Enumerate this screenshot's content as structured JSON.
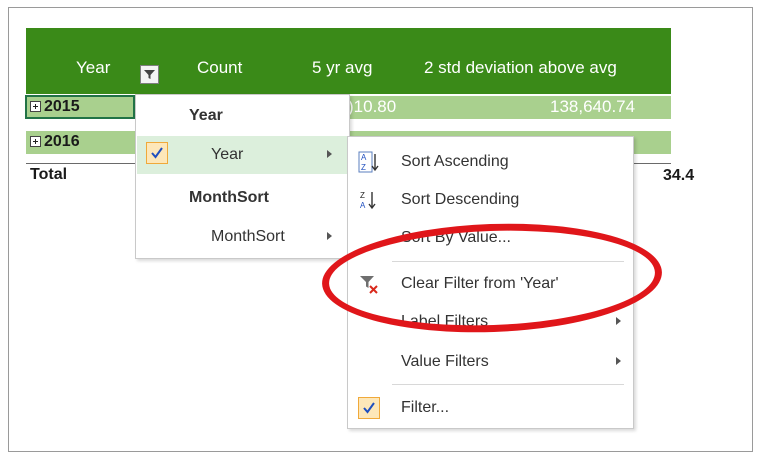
{
  "pivot": {
    "headers": {
      "year": "Year",
      "count": "Count",
      "avg": "5 yr avg",
      "std": "2 std deviation above avg"
    },
    "rows": [
      {
        "label": "2015",
        "avg_visible": ")10.80",
        "std_value": "138,640.74"
      },
      {
        "label": "2016",
        "avg_visible": "",
        "std_value": ""
      }
    ],
    "total": {
      "label": "Total",
      "value_visible": "34.4"
    }
  },
  "field_menu": {
    "group1": "Year",
    "item1": "Year",
    "group2": "MonthSort",
    "item2": "MonthSort"
  },
  "sort_menu": {
    "items": [
      {
        "label": "Sort Ascending",
        "icon": "sort-ascending-icon"
      },
      {
        "label": "Sort Descending",
        "icon": "sort-descending-icon"
      },
      {
        "label": "Sort By Value..."
      },
      {
        "label": "Clear Filter from 'Year'",
        "icon": "clear-filter-icon"
      },
      {
        "label": "Label Filters"
      },
      {
        "label": "Value Filters"
      },
      {
        "label": "Filter...",
        "icon": "check-icon"
      }
    ]
  },
  "colors": {
    "header_green": "#3a8a18",
    "row_green": "#a9d08e",
    "annotation_red": "#e0161a",
    "check_orange": "#f0a93a"
  }
}
